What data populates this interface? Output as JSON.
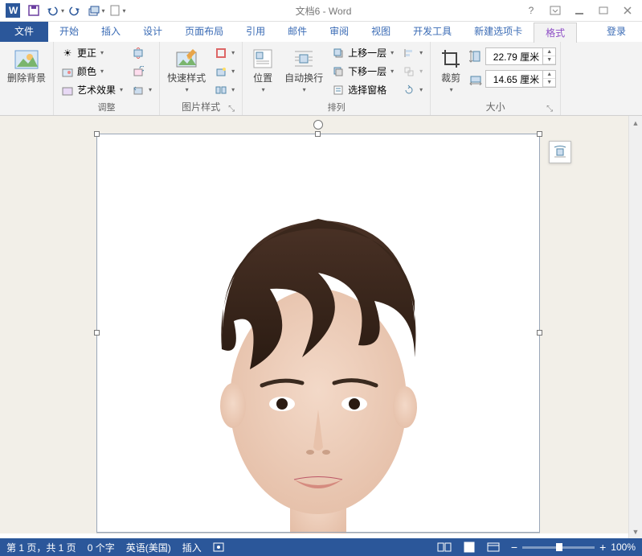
{
  "title": "文档6 - Word",
  "tabs": {
    "file": "文件",
    "items": [
      "开始",
      "插入",
      "设计",
      "页面布局",
      "引用",
      "邮件",
      "审阅",
      "视图",
      "开发工具",
      "新建选项卡"
    ],
    "active": "格式",
    "login": "登录"
  },
  "ribbon": {
    "remove_bg": "删除背景",
    "adjust": {
      "correct": "更正",
      "color": "颜色",
      "artistic": "艺术效果",
      "label": "调整"
    },
    "styles": {
      "quick": "快速样式",
      "label": "图片样式"
    },
    "arrange": {
      "position": "位置",
      "wrap": "自动换行",
      "forward": "上移一层",
      "backward": "下移一层",
      "selpane": "选择窗格",
      "label": "排列"
    },
    "size": {
      "crop": "裁剪",
      "height": "22.79 厘米",
      "width": "14.65 厘米",
      "label": "大小"
    }
  },
  "status": {
    "page": "第 1 页，共 1 页",
    "words": "0 个字",
    "lang": "英语(美国)",
    "mode": "插入",
    "zoom": "100%"
  }
}
